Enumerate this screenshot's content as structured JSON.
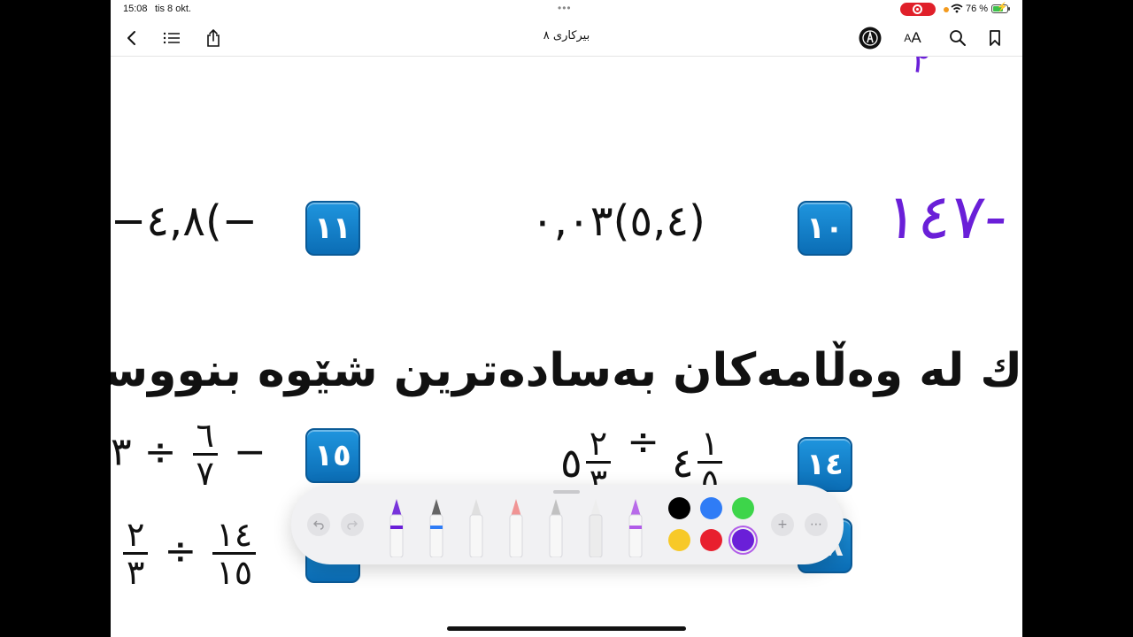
{
  "status_bar": {
    "time": "15:08",
    "date": "tis 8 okt.",
    "battery_percent": "76 %",
    "battery_level": 0.76
  },
  "toolbar": {
    "title": "بیرکاری ٨",
    "font_size_label_small": "A",
    "font_size_label_large": "A"
  },
  "page": {
    "exercise_10": {
      "number": "١٠",
      "expression": "(٥,٤)٠,٠٣"
    },
    "exercise_11": {
      "number": "١١",
      "expression": "−)٤,٨−"
    },
    "exercise_14": {
      "number": "١٤",
      "whole_a": "٥",
      "num_a": "٢",
      "den_a": "٣",
      "operator": "÷",
      "whole_b": "٤",
      "num_b": "١",
      "den_b": "٥"
    },
    "exercise_15": {
      "number": "١٥",
      "lead": "٣",
      "operator": "÷",
      "num": "٦",
      "den": "٧",
      "sign": "−"
    },
    "exercise_18": {
      "number": "١٨"
    },
    "bottom_fraction_a": {
      "num": "٢",
      "den": "٣"
    },
    "bottom_operator": "÷",
    "bottom_fraction_b": {
      "num": "١٤",
      "den": "١٥"
    },
    "instruction": "ك له وه‌ڵامه‌كان به‌ساده‌ترین شێوه‌ بنووسه",
    "handwritten_answer": "١٤٧-",
    "handwritten_top": "٢"
  },
  "markup_palette": {
    "colors": [
      "#000000",
      "#2f7cf6",
      "#3dd54a",
      "#f7c928",
      "#e8202e",
      "#6a1fd8"
    ],
    "selected_color": "#6a1fd8",
    "add_label": "+",
    "more_label": "⋯"
  }
}
